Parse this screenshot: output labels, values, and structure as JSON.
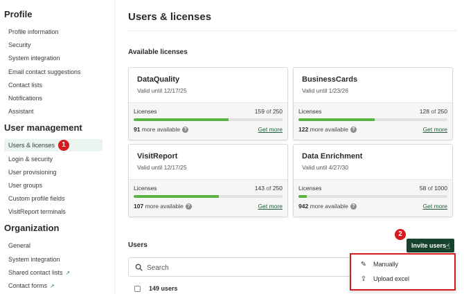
{
  "sidebar": {
    "sections": [
      {
        "heading": "Profile",
        "items": [
          {
            "label": "Profile information"
          },
          {
            "label": "Security"
          },
          {
            "label": "System integration"
          },
          {
            "label": "Email contact suggestions"
          },
          {
            "label": "Contact lists"
          },
          {
            "label": "Notifications"
          },
          {
            "label": "Assistant"
          }
        ]
      },
      {
        "heading": "User management",
        "items": [
          {
            "label": "Users & licenses"
          },
          {
            "label": "Login & security"
          },
          {
            "label": "User provisioning"
          },
          {
            "label": "User groups"
          },
          {
            "label": "Custom profile fields"
          },
          {
            "label": "VisitReport terminals"
          }
        ]
      },
      {
        "heading": "Organization",
        "items": [
          {
            "label": "General"
          },
          {
            "label": "System integration"
          },
          {
            "label": "Shared contact lists"
          },
          {
            "label": "Contact forms"
          }
        ]
      }
    ]
  },
  "annotations": {
    "badge1": "1",
    "badge2": "2",
    "badge_color": "#d71920"
  },
  "main": {
    "title": "Users & licenses",
    "available_heading": "Available licenses",
    "licenses": [
      {
        "name": "DataQuality",
        "valid": "Valid until 12/17/25",
        "label": "Licenses",
        "used": "159",
        "of": "of",
        "total": "250",
        "fill_fraction": 0.636,
        "more_count": "91",
        "more_text": "more available",
        "link": "Get more"
      },
      {
        "name": "BusinessCards",
        "valid": "Valid until 1/23/26",
        "label": "Licenses",
        "used": "128",
        "of": "of",
        "total": "250",
        "fill_fraction": 0.512,
        "more_count": "122",
        "more_text": "more available",
        "link": "Get more"
      },
      {
        "name": "VisitReport",
        "valid": "Valid until 12/17/25",
        "label": "Licenses",
        "used": "143",
        "of": "of",
        "total": "250",
        "fill_fraction": 0.572,
        "more_count": "107",
        "more_text": "more available",
        "link": "Get more"
      },
      {
        "name": "Data Enrichment",
        "valid": "Valid until 4/27/30",
        "label": "Licenses",
        "used": "58",
        "of": "of",
        "total": "1000",
        "fill_fraction": 0.058,
        "more_count": "942",
        "more_text": "more available",
        "link": "Get more"
      }
    ],
    "users_heading": "Users",
    "search_placeholder": "Search",
    "users_count": "149 users",
    "invite_label": "Invite users",
    "dropdown": [
      {
        "label": "Manually",
        "icon": "pencil-icon"
      },
      {
        "label": "Upload excel",
        "icon": "upload-icon"
      }
    ]
  },
  "colors": {
    "accent": "#16432c",
    "progress": "#5bb544",
    "active_bg": "#e9f5ee",
    "link": "#1e5f3a"
  }
}
